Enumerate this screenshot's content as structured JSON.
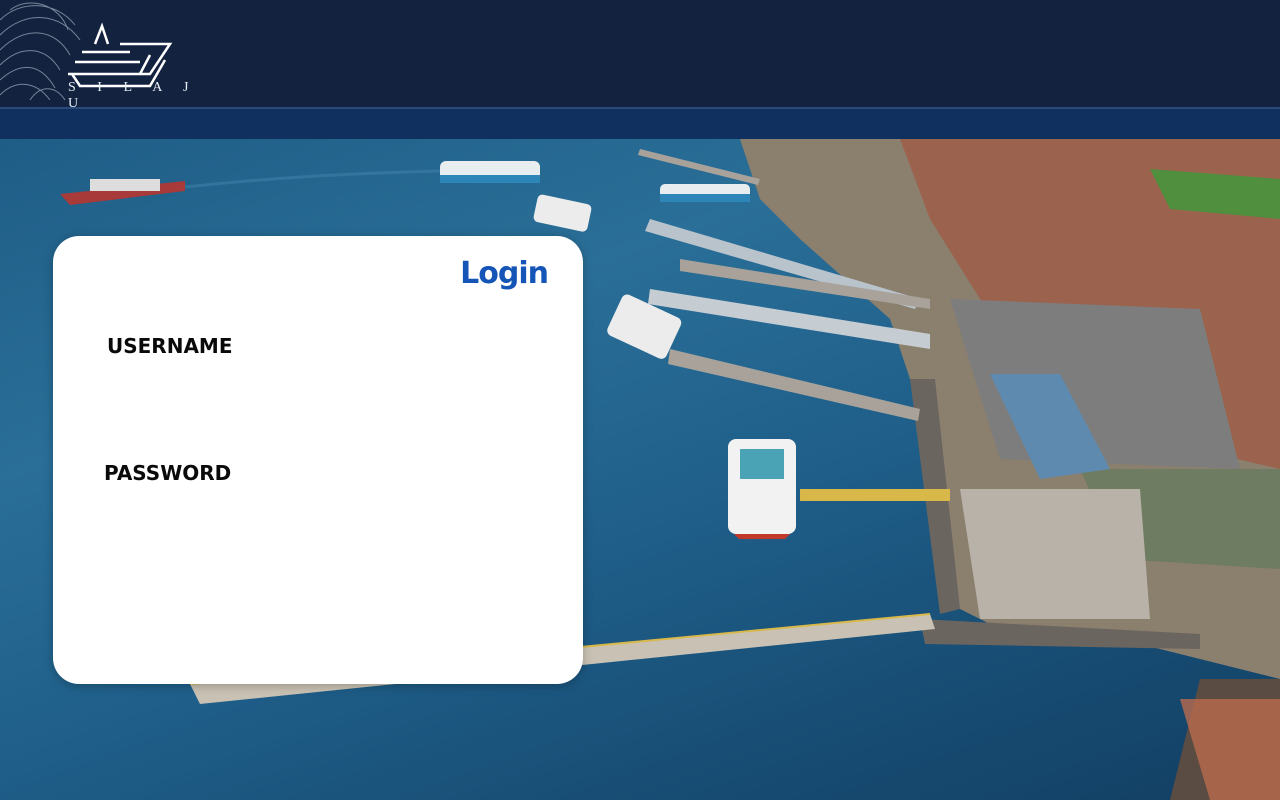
{
  "header": {
    "brand": "SILAJU",
    "brand_display": "S I L A J U"
  },
  "login": {
    "title": "Login",
    "username_label": "USERNAME",
    "password_label": "PASSWORD",
    "username_value": "",
    "password_value": ""
  },
  "colors": {
    "header_bg": "#13233f",
    "subbar_bg": "#10305f",
    "accent": "#1555b7",
    "card_bg": "#ffffff"
  },
  "background": {
    "icon": "harbor-aerial-photo"
  }
}
